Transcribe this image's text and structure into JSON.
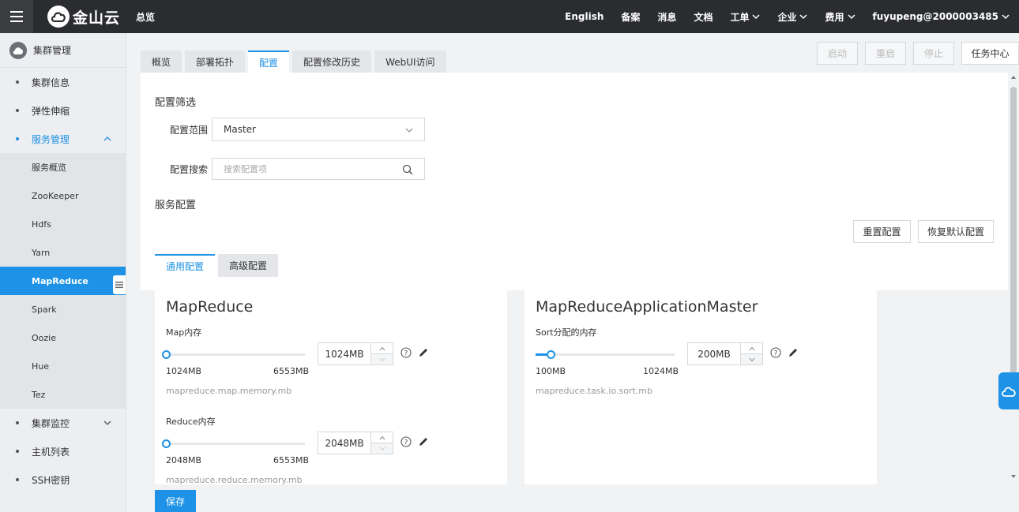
{
  "header": {
    "logo_text": "金山云",
    "overview": "总览",
    "nav": [
      {
        "label": "English",
        "has_dropdown": false
      },
      {
        "label": "备案",
        "has_dropdown": false
      },
      {
        "label": "消息",
        "has_dropdown": false
      },
      {
        "label": "文档",
        "has_dropdown": false
      },
      {
        "label": "工单",
        "has_dropdown": true
      },
      {
        "label": "企业",
        "has_dropdown": true
      },
      {
        "label": "费用",
        "has_dropdown": true
      },
      {
        "label": "fuyupeng@2000003485",
        "has_dropdown": true
      }
    ]
  },
  "sidebar": {
    "title": "集群管理",
    "items": {
      "cluster_info": "集群信息",
      "elastic_scaling": "弹性伸缩",
      "service_mgmt": "服务管理",
      "cluster_monitor": "集群监控",
      "host_list": "主机列表",
      "ssh_keys": "SSH密钥"
    },
    "services": [
      "服务概览",
      "ZooKeeper",
      "Hdfs",
      "Yarn",
      "MapReduce",
      "Spark",
      "Oozie",
      "Hue",
      "Tez"
    ],
    "active_service": "MapReduce"
  },
  "tabs": [
    "概览",
    "部署拓扑",
    "配置",
    "配置修改历史",
    "WebUI访问"
  ],
  "active_tab": "配置",
  "actions": {
    "start": "启动",
    "restart": "重启",
    "stop": "停止",
    "task_center": "任务中心"
  },
  "filter": {
    "title": "配置筛选",
    "scope_label": "配置范围",
    "scope_value": "Master",
    "search_label": "配置搜索",
    "search_placeholder": "搜索配置项"
  },
  "service_config": {
    "title": "服务配置",
    "reset_button": "重置配置",
    "restore_default_button": "恢复默认配置",
    "subtabs": [
      "通用配置",
      "高级配置"
    ],
    "active_subtab": "通用配置"
  },
  "cards": [
    {
      "title": "MapReduce",
      "params": [
        {
          "label": "Map内存",
          "value": "1024MB",
          "min": "1024MB",
          "max": "6553MB",
          "key": "mapreduce.map.memory.mb",
          "position": 0
        },
        {
          "label": "Reduce内存",
          "value": "2048MB",
          "min": "2048MB",
          "max": "6553MB",
          "key": "mapreduce.reduce.memory.mb",
          "position": 0
        }
      ]
    },
    {
      "title": "MapReduceApplicationMaster",
      "params": [
        {
          "label": "Sort分配的内存",
          "value": "200MB",
          "min": "100MB",
          "max": "1024MB",
          "key": "mapreduce.task.io.sort.mb",
          "position": 0.108
        }
      ]
    }
  ],
  "save_button": "保存",
  "colors": {
    "accent": "#1d92e6",
    "topbar": "#2a2c30",
    "sidebar": "#eceef1"
  }
}
